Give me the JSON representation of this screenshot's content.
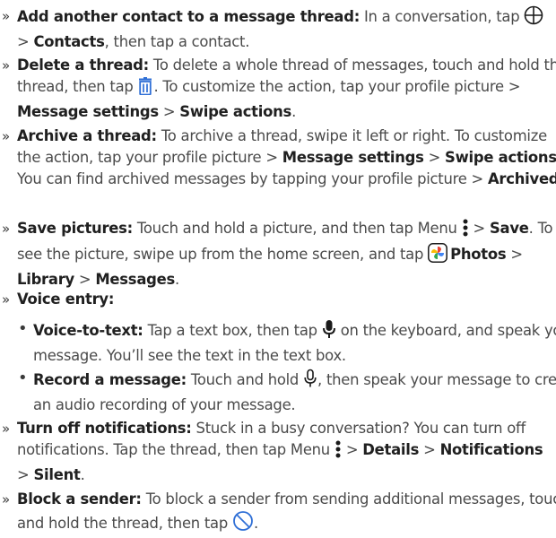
{
  "items": [
    {
      "lead": "Add another contact to a message thread:",
      "t1": " In a conversation, tap ",
      "icon1": "add-circle-icon",
      "t2": " > ",
      "b1": "Contacts",
      "t3": ", then tap a contact."
    },
    {
      "lead": "Delete a thread:",
      "t1": " To delete a whole thread of messages, touch and hold the thread, then tap ",
      "icon1": "trash-icon",
      "t2": ". To customize the action, tap your profile picture > ",
      "b1": "Message settings",
      "t3": " > ",
      "b2": "Swipe actions",
      "t4": "."
    },
    {
      "lead": "Archive a thread:",
      "t1": " To archive a thread, swipe it left or right. To customize the action, tap your profile picture > ",
      "b1": "Message settings",
      "t2": " > ",
      "b2": "Swipe actions",
      "t3": ". You can find archived messages by tapping your profile picture > ",
      "b3": "Archived",
      "t4": "."
    },
    {
      "lead": "Save pictures:",
      "t1": " Touch and hold a picture, and then tap Menu ",
      "icon1": "menu-dots-icon",
      "t2": " > ",
      "b1": "Save",
      "t3": ". To see the picture, swipe up from the home screen, and tap ",
      "icon2": "photos-app-icon",
      "b2": "Photos",
      "t4": " > ",
      "b3": "Library",
      "t5": " > ",
      "b4": "Messages",
      "t6": "."
    },
    {
      "lead": "Voice entry:"
    },
    {
      "lead": "Voice-to-text:",
      "t1": " Tap a text box, then tap ",
      "icon1": "microphone-icon",
      "t2": " on the keyboard, and speak your message. You’ll see the text in the text box."
    },
    {
      "lead": "Record a message:",
      "t1": " Touch and hold ",
      "icon1": "microphone-outline-icon",
      "t2": ", then speak your message to create an audio recording of your message."
    },
    {
      "lead": "Turn off notifications:",
      "t1": " Stuck in a busy conversation? You can turn off notifications. Tap the thread, then tap Menu ",
      "icon1": "menu-dots-icon",
      "t2": " > ",
      "b1": "Details",
      "t3": " > ",
      "b2": "Notifications",
      "t4": " > ",
      "b3": "Silent",
      "t5": "."
    },
    {
      "lead": "Block a sender:",
      "t1": " To block a sender from sending additional messages, touch and hold the thread, then tap ",
      "icon1": "block-icon",
      "t2": "."
    }
  ],
  "markers": {
    "chevron": "»",
    "dot": "•"
  },
  "colors": {
    "text": "#4a4a4a",
    "bold": "#202020",
    "icon": "#1a1a1a",
    "trash": "#2f6fd6",
    "block": "#2f6fd6"
  }
}
